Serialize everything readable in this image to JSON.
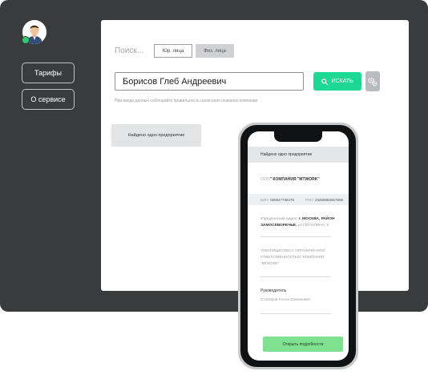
{
  "sidebar": {
    "items": [
      {
        "label": "Тарифы"
      },
      {
        "label": "О сервисе"
      }
    ]
  },
  "search": {
    "label": "Поиск...",
    "tabs": [
      {
        "label": "Юр. лица"
      },
      {
        "label": "Физ. лица"
      }
    ],
    "value": "Борисов Глеб Андреевич",
    "button_label": "ИСКАТЬ",
    "hint": "При вводе данных соблюдайте правильность написания названия компании"
  },
  "result": {
    "found_label": "Найдено одно предприятие"
  },
  "phone": {
    "title": "Найдено одно предприятие",
    "company_prefix": "ООО",
    "company_name": "\" КОМПАНИЯ \"МТWORK\"",
    "bin_label": "БИН:",
    "bin_value": "080847738475",
    "rnn_label": "РНН:",
    "rnn_value": "23468984657896",
    "address_label": "Юридический адрес:",
    "address_value": "г. МОСКВА, РАЙОН ЗАМОСКВОРЕЧЬЕ,",
    "address_street": "ул ПОТАНИНА, 6",
    "legal_form": "ТОВАРИЩЕСТВО С ОГРАНИЧЕННОЙ ОТВЕТСТВЕННОСТЬЮ \"КОМПАНИЯ \"МТWORK\"",
    "manager_label": "Руководитель",
    "manager_name": "Столяров Антон Семенович",
    "open_button": "Открыть подробности"
  },
  "colors": {
    "panel": "#3a3b3d",
    "accent_green": "#1ed895",
    "open_button": "#7fe08f"
  }
}
